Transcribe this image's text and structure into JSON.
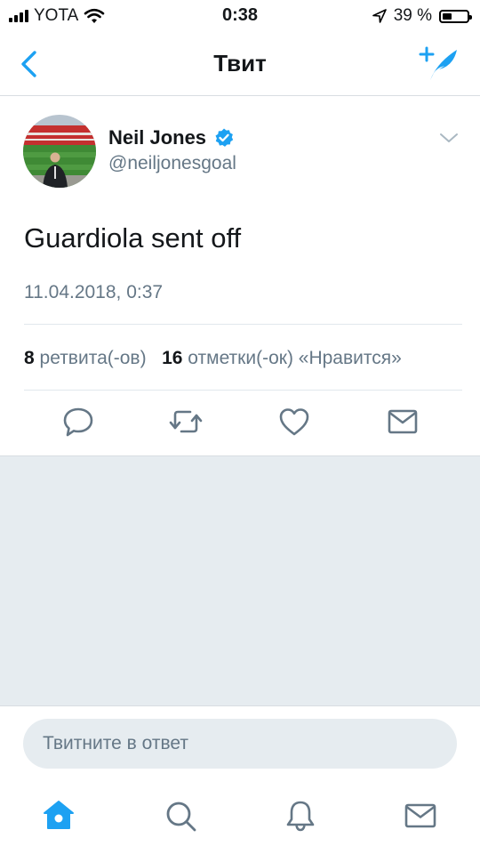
{
  "status_bar": {
    "carrier": "YOTA",
    "time": "0:38",
    "battery_percent": "39 %",
    "battery_level": 0.39,
    "icons": [
      "signal-icon",
      "wifi-icon",
      "location-arrow-icon",
      "battery-icon"
    ]
  },
  "nav": {
    "title": "Твит",
    "icons": [
      "back-chevron-icon",
      "compose-tweet-icon"
    ]
  },
  "tweet": {
    "author_name": "Neil Jones",
    "author_handle": "@neiljonesgoal",
    "text": "Guardiola sent off",
    "timestamp": "11.04.2018, 0:37",
    "retweet_count": "8",
    "retweet_label": "ретвита(-ов)",
    "like_count": "16",
    "like_label": "отметки(-ок) «Нравится»",
    "icons": [
      "verified-badge-icon",
      "chevron-down-icon",
      "reply-icon",
      "retweet-icon",
      "like-icon",
      "dm-icon"
    ]
  },
  "reply": {
    "placeholder": "Твитните в ответ"
  },
  "tabbar": {
    "icons": [
      "home-icon",
      "search-icon",
      "notifications-icon",
      "messages-icon"
    ]
  },
  "colors": {
    "accent": "#1da1f2",
    "text_primary": "#14171a",
    "text_secondary": "#657786",
    "background_gray": "#e6ecf0",
    "divider": "#e1e8ed"
  }
}
